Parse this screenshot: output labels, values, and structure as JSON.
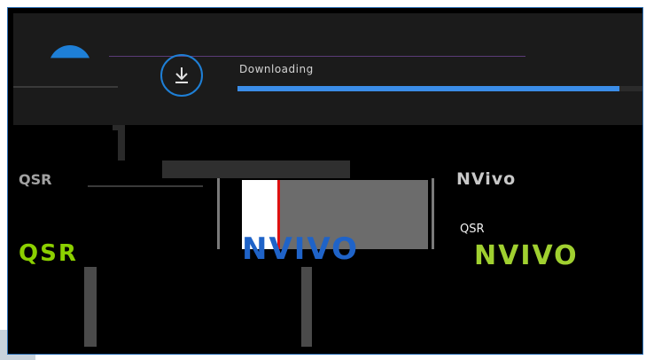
{
  "dialog": {
    "status_label": "Downloading",
    "progress": 0.94,
    "icon": "download-icon"
  },
  "content": {
    "left_brand": "QSR",
    "right_brand": "NVivo",
    "qsr_label": "QSR",
    "nvivo_logo": "NVIVO",
    "green_left": "QSR",
    "green_right": "NVIVO"
  },
  "colors": {
    "accent": "#1e7fd6",
    "progress": "#3b8de8",
    "nvivo_blue": "#1f63c8",
    "green": "#8cd000"
  }
}
